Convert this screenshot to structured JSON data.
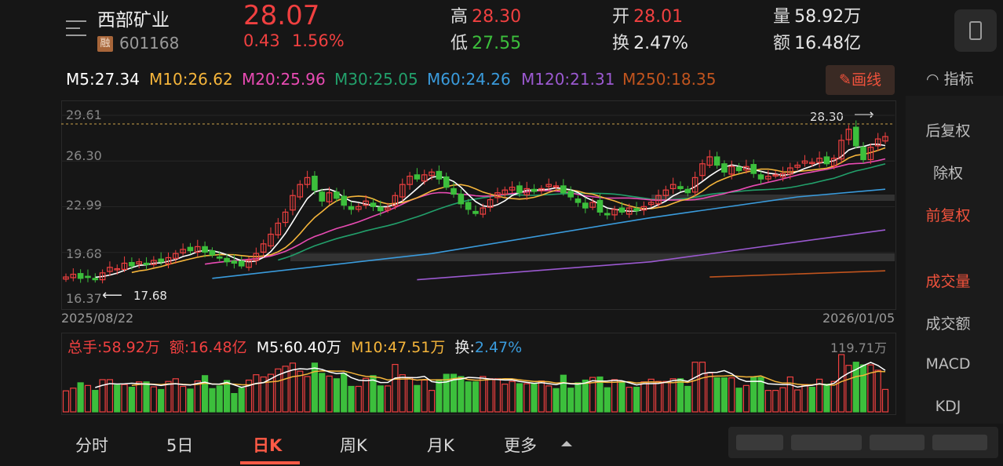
{
  "header": {
    "stock_name": "西部矿业",
    "rong_tag": "融",
    "stock_code": "601168",
    "price": "28.07",
    "change": "0.43",
    "change_pct": "1.56%",
    "high_label": "高",
    "high_value": "28.30",
    "low_label": "低",
    "low_value": "27.55",
    "open_label": "开",
    "open_value": "28.01",
    "turnover_label": "换",
    "turnover_value": "2.47%",
    "volume_label": "量",
    "volume_value": "58.92万",
    "amount_label": "额",
    "amount_value": "16.48亿"
  },
  "ma_legend": [
    {
      "text": "M5:27.34",
      "color": "#ffffff"
    },
    {
      "text": "M10:26.62",
      "color": "#f5b53b"
    },
    {
      "text": "M20:25.96",
      "color": "#e84bb3"
    },
    {
      "text": "M30:25.05",
      "color": "#22a06b"
    },
    {
      "text": "M60:24.26",
      "color": "#3a9bdc"
    },
    {
      "text": "M120:21.31",
      "color": "#9b59d0"
    },
    {
      "text": "M250:18.35",
      "color": "#c0541e"
    }
  ],
  "draw_button": {
    "icon": "pencil-icon",
    "label": "画线"
  },
  "indicator_label": "指标",
  "right_panel": [
    "后复权",
    "除权",
    "前复权",
    "成交量",
    "成交额",
    "MACD",
    "KDJ"
  ],
  "right_panel_active": [
    "前复权",
    "成交量"
  ],
  "y_axis": [
    "29.61",
    "26.30",
    "22.99",
    "19.68",
    "16.37"
  ],
  "dates": {
    "start": "2025/08/22",
    "end": "2026/01/05"
  },
  "annotations": {
    "high": "28.30",
    "low": "17.68"
  },
  "volume_info": {
    "total": "总手:58.92万",
    "amount": "额:16.48亿",
    "m5": "M5:60.40万",
    "m10": "M10:47.51万",
    "turnover_label": "换:",
    "turnover_value": "2.47%",
    "max": "119.71万"
  },
  "tabs": [
    {
      "label": "分时",
      "active": false
    },
    {
      "label": "5日",
      "active": false
    },
    {
      "label": "日K",
      "active": true
    },
    {
      "label": "周K",
      "active": false
    },
    {
      "label": "月K",
      "active": false
    },
    {
      "label": "更多",
      "active": false
    }
  ],
  "colors": {
    "up": "#f04040",
    "down": "#3cbf3c",
    "accent": "#ff5a46"
  },
  "chart_data": {
    "type": "candlestick",
    "ylim": [
      16.37,
      29.61
    ],
    "y_ticks": [
      29.61,
      26.3,
      22.99,
      19.68,
      16.37
    ],
    "closes": [
      17.9,
      18.1,
      17.8,
      17.9,
      17.7,
      18.2,
      18.6,
      18.5,
      18.9,
      18.7,
      19.0,
      18.8,
      19.1,
      19.0,
      19.3,
      19.6,
      19.9,
      19.8,
      20.1,
      19.7,
      19.5,
      19.3,
      19.0,
      18.9,
      18.7,
      19.1,
      19.6,
      20.3,
      21.0,
      21.8,
      22.6,
      23.8,
      24.6,
      25.1,
      24.2,
      23.4,
      24.0,
      23.6,
      23.1,
      22.8,
      23.0,
      23.4,
      23.0,
      22.7,
      22.9,
      23.8,
      24.6,
      25.2,
      25.0,
      25.3,
      25.5,
      25.0,
      24.4,
      23.9,
      23.2,
      22.8,
      22.5,
      22.9,
      23.5,
      24.0,
      24.2,
      24.4,
      24.0,
      24.3,
      24.1,
      24.3,
      24.6,
      24.5,
      24.0,
      23.7,
      23.3,
      22.9,
      23.3,
      22.6,
      22.4,
      22.8,
      22.6,
      22.9,
      22.7,
      23.0,
      23.3,
      23.8,
      24.2,
      24.6,
      24.3,
      24.0,
      25.1,
      26.1,
      26.6,
      26.0,
      25.5,
      25.9,
      25.6,
      25.9,
      25.4,
      25.0,
      25.2,
      25.3,
      25.4,
      25.8,
      26.0,
      26.3,
      26.2,
      26.5,
      26.1,
      26.5,
      27.8,
      28.6,
      27.4,
      26.4,
      27.3,
      27.9,
      28.07
    ],
    "ma_series": [
      "M5",
      "M10",
      "M20",
      "M30",
      "M60",
      "M120",
      "M250"
    ],
    "volume_max": "119.71万",
    "volume_series": [
      "M5",
      "M10"
    ]
  }
}
